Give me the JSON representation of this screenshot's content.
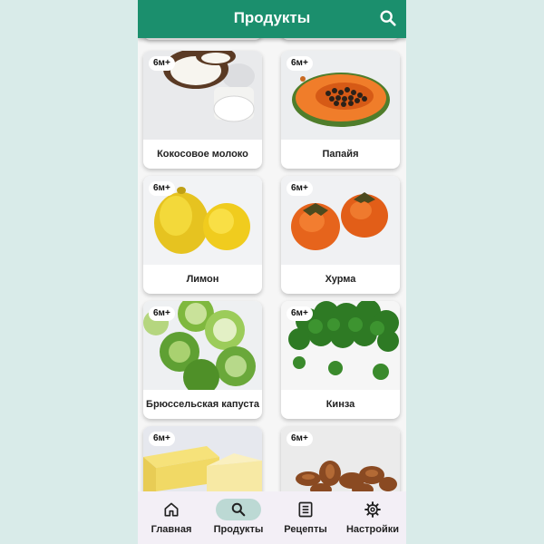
{
  "appbar": {
    "title": "Продукты",
    "search_icon": "search-icon"
  },
  "products": [
    {
      "name": "",
      "badge": ""
    },
    {
      "name": "",
      "badge": ""
    },
    {
      "name": "Кокосовое молоко",
      "badge": "6м+"
    },
    {
      "name": "Папайя",
      "badge": "6м+"
    },
    {
      "name": "Лимон",
      "badge": "6м+"
    },
    {
      "name": "Хурма",
      "badge": "6м+"
    },
    {
      "name": "Брюссельская капуста",
      "badge": "6м+"
    },
    {
      "name": "Кинза",
      "badge": "6м+"
    },
    {
      "name": "",
      "badge": "6м+"
    },
    {
      "name": "",
      "badge": "6м+"
    }
  ],
  "nav": {
    "items": [
      {
        "label": "Главная",
        "icon": "home-icon"
      },
      {
        "label": "Продукты",
        "icon": "search-icon"
      },
      {
        "label": "Рецепты",
        "icon": "list-icon"
      },
      {
        "label": "Настройки",
        "icon": "gear-icon"
      }
    ],
    "active_index": 1
  },
  "colors": {
    "primary": "#1b8f6d",
    "background": "#d9ebe9",
    "nav_active": "#bcd9d4"
  }
}
